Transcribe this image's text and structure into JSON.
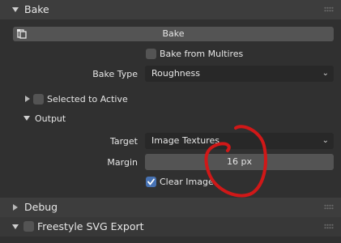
{
  "bake_panel": {
    "title": "Bake",
    "bake_button_label": "Bake",
    "bake_from_multires_label": "Bake from Multires",
    "bake_from_multires_checked": false,
    "bake_type_label": "Bake Type",
    "bake_type_value": "Roughness"
  },
  "selected_to_active": {
    "label": "Selected to Active",
    "checked": false
  },
  "output_panel": {
    "title": "Output",
    "target_label": "Target",
    "target_value": "Image Textures",
    "margin_label": "Margin",
    "margin_value": "16 px",
    "clear_image_label": "Clear Image",
    "clear_image_checked": true
  },
  "debug_panel": {
    "title": "Debug"
  },
  "freestyle_panel": {
    "title": "Freestyle SVG Export",
    "checked": false
  },
  "annotation": {
    "color": "#d01818"
  }
}
